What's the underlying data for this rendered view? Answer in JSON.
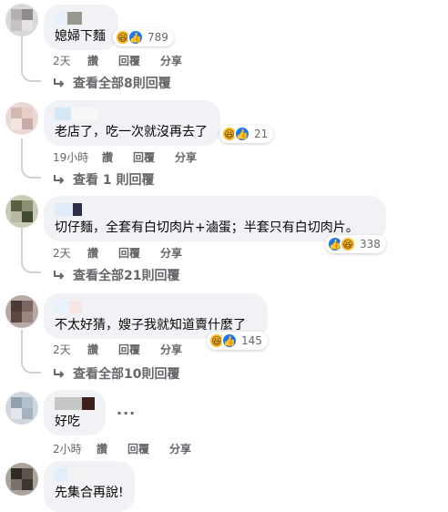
{
  "comments": [
    {
      "text": "媳婦下麵",
      "reaction_count": "789",
      "time": "2天",
      "actions": [
        "讚",
        "回覆",
        "分享"
      ],
      "view_replies": "查看全部8則回覆"
    },
    {
      "text": "老店了，吃一次就沒再去了",
      "reaction_count": "21",
      "time": "19小時",
      "actions": [
        "讚",
        "回覆",
        "分享"
      ],
      "view_replies": "查看 1 則回覆"
    },
    {
      "text": "切仔麵，全套有白切肉片+滷蛋；半套只有白切肉片。",
      "reaction_count": "338",
      "time": "2天",
      "actions": [
        "讚",
        "回覆",
        "分享"
      ],
      "view_replies": "查看全部21則回覆"
    },
    {
      "text": "不太好猜，嫂子我就知道賣什麼了",
      "reaction_count": "145",
      "time": "2天",
      "actions": [
        "讚",
        "回覆",
        "分享"
      ],
      "view_replies": "查看全部10則回覆"
    },
    {
      "text": "好吃",
      "more": "···",
      "time": "2小時",
      "actions": [
        "讚",
        "回覆",
        "分享"
      ]
    },
    {
      "text": "先集合再說!"
    }
  ],
  "colors": {
    "bubble": "#f0f2f5",
    "meta_text": "#65676b",
    "like_blue": "#1877f2",
    "haha_yellow": "#f7b928"
  },
  "icons": {
    "haha": "laughing-face-emoji",
    "like": "thumbs-up",
    "reply": "reply-arrow"
  }
}
